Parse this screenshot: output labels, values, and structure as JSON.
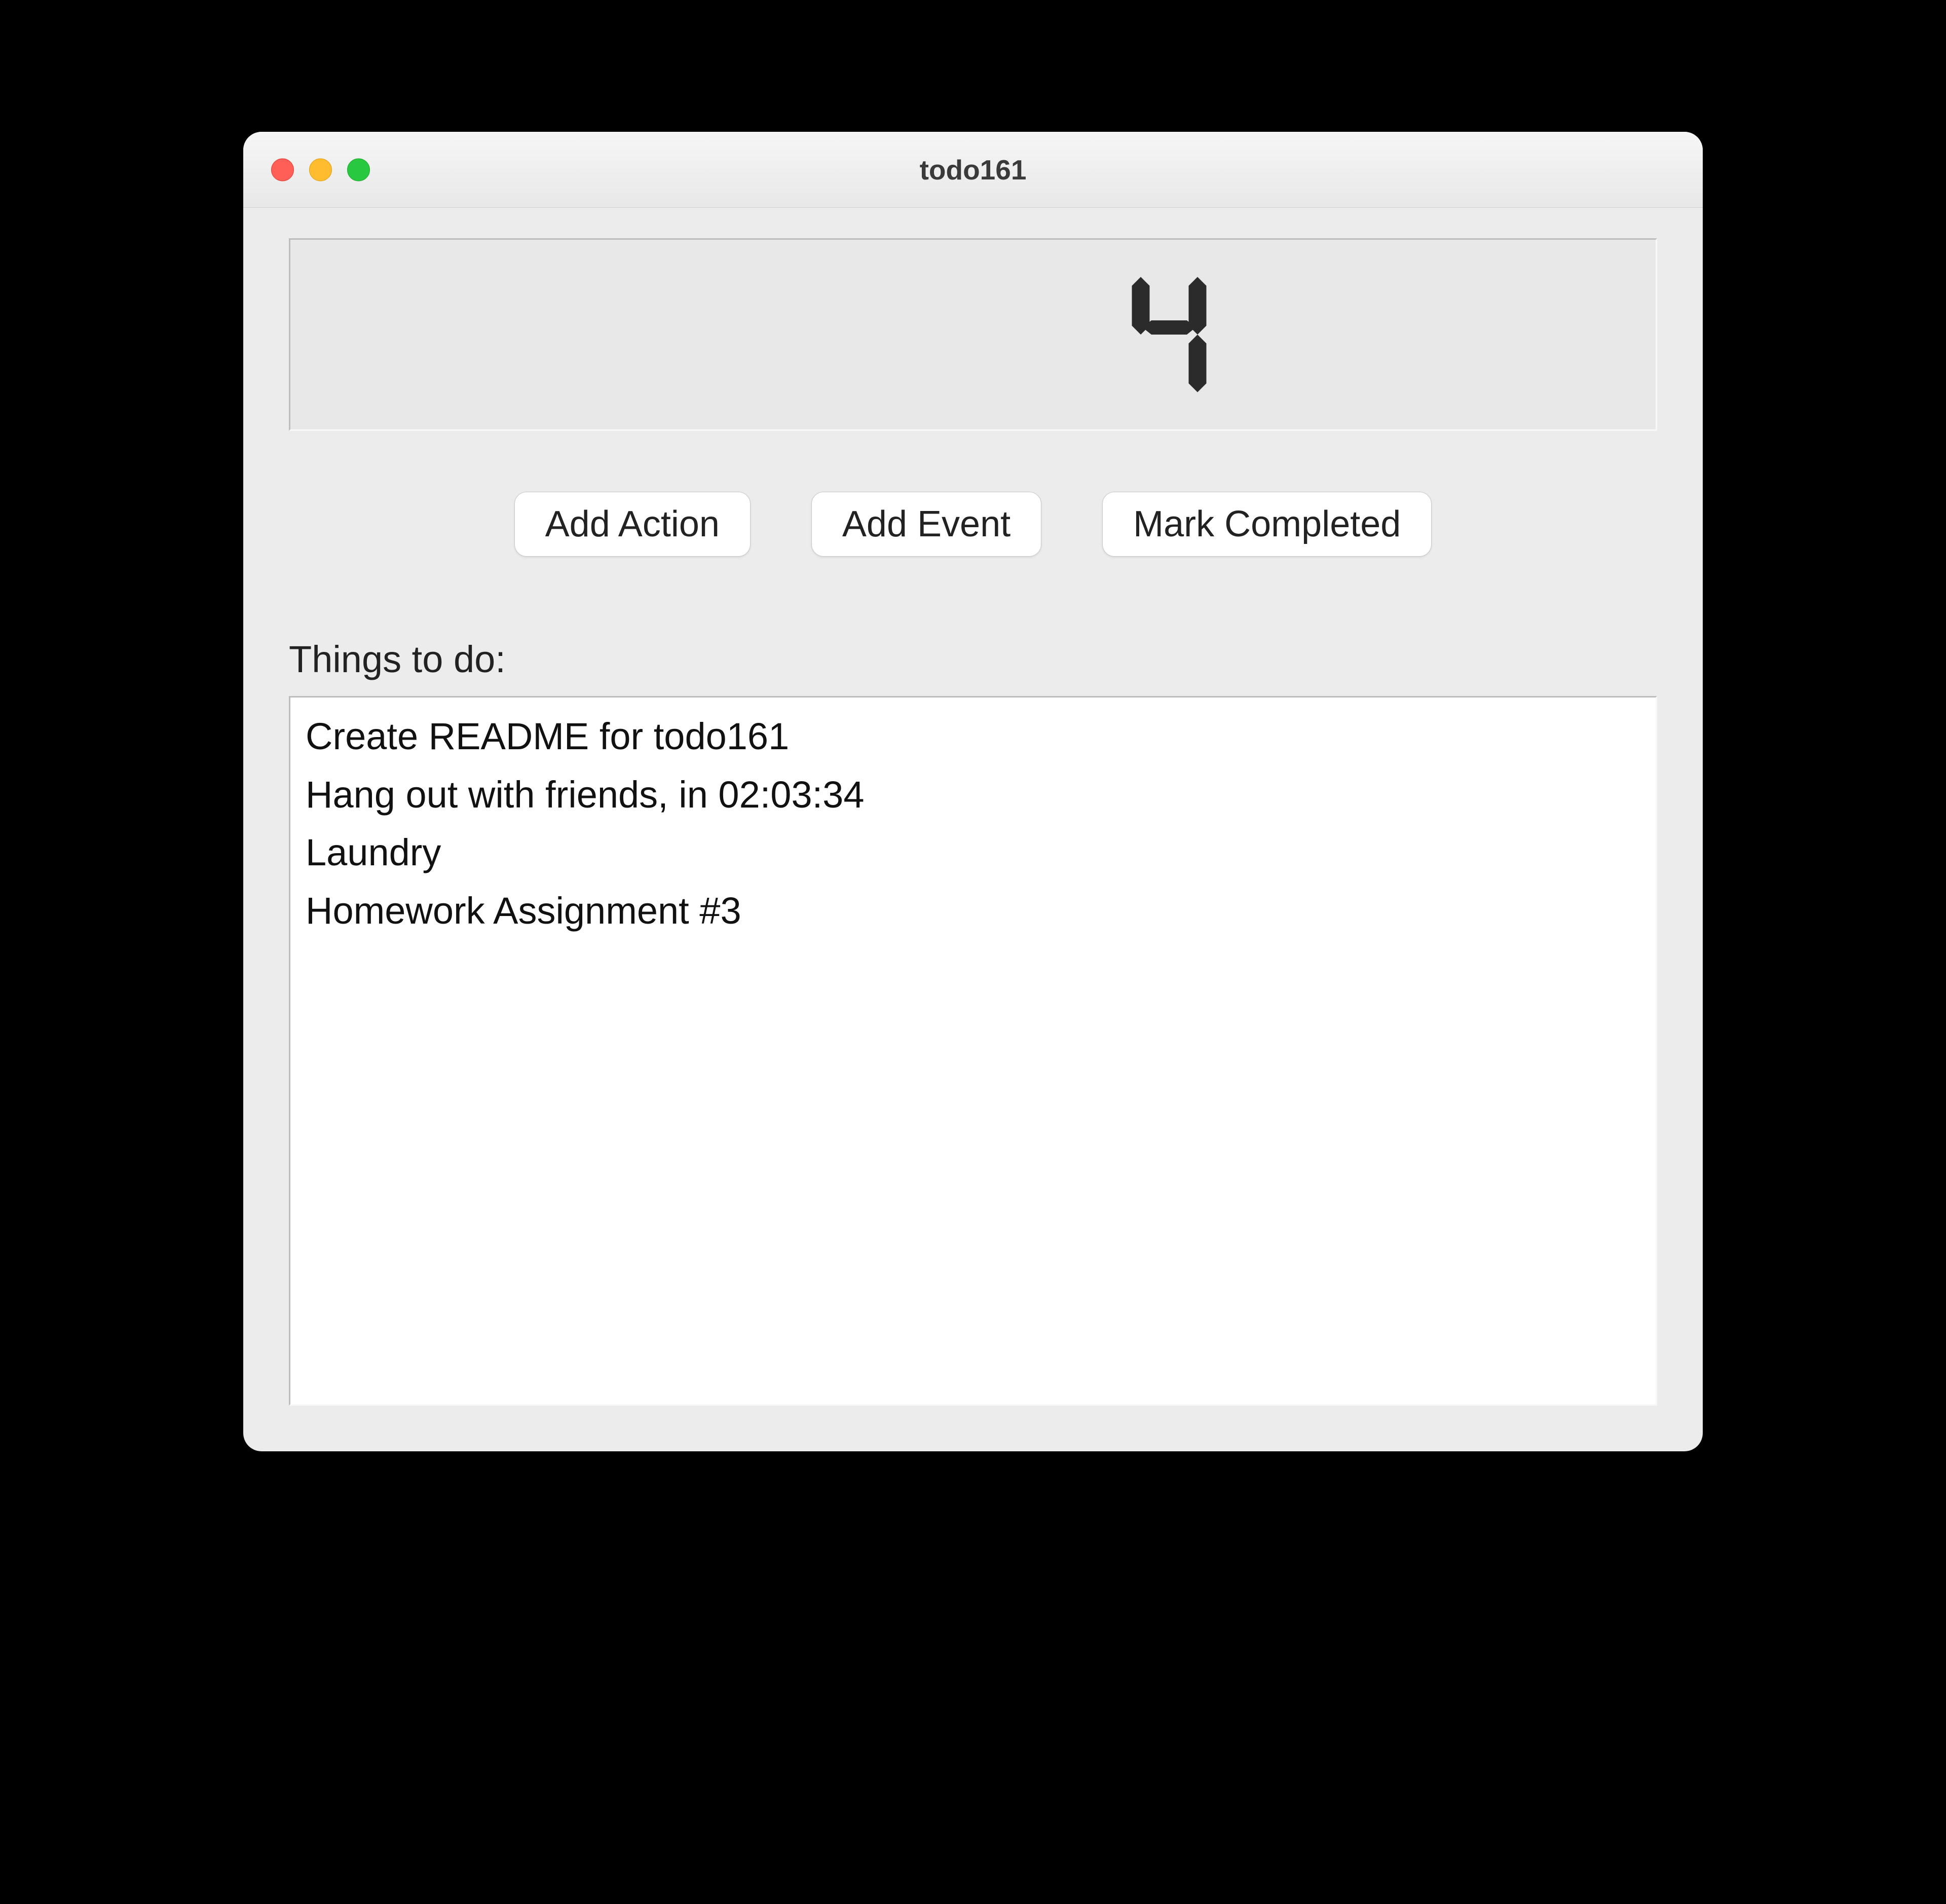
{
  "window": {
    "title": "todo161"
  },
  "counter": {
    "value": "4"
  },
  "buttons": {
    "add_action": "Add Action",
    "add_event": "Add Event",
    "mark_completed": "Mark Completed"
  },
  "section": {
    "heading": "Things to do:"
  },
  "todos": [
    "Create README for todo161",
    "Hang out with friends, in 02:03:34",
    "Laundry",
    "Homework Assignment #3"
  ]
}
